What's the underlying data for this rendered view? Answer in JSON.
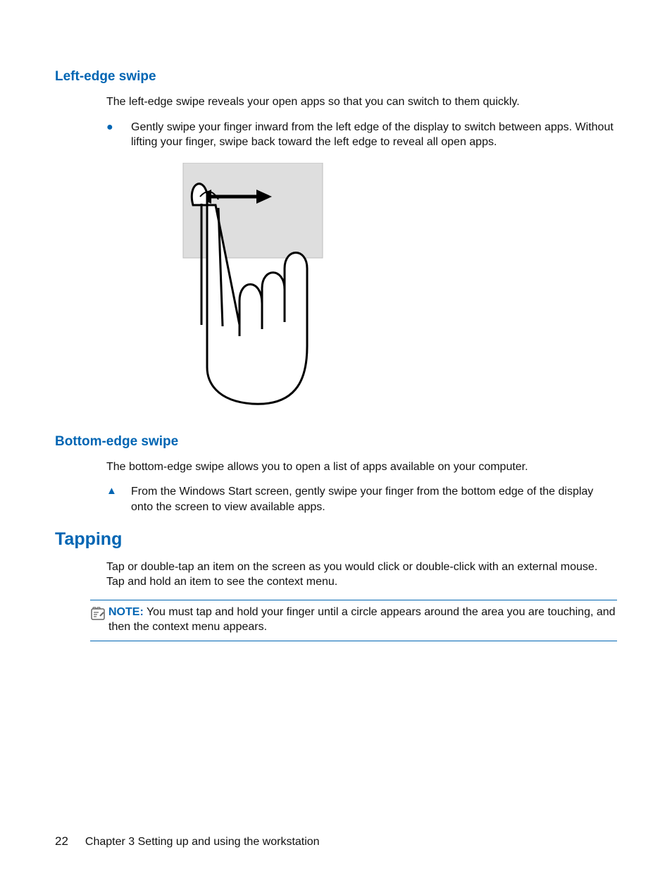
{
  "section1": {
    "heading": "Left-edge swipe",
    "intro": "The left-edge swipe reveals your open apps so that you can switch to them quickly.",
    "bullet": "Gently swipe your finger inward from the left edge of the display to switch between apps. Without lifting your finger, swipe back toward the left edge to reveal all open apps."
  },
  "section2": {
    "heading": "Bottom-edge swipe",
    "intro": "The bottom-edge swipe allows you to open a list of apps available on your computer.",
    "bullet": "From the Windows Start screen, gently swipe your finger from the bottom edge of the display onto the screen to view available apps."
  },
  "section3": {
    "heading": "Tapping",
    "intro": "Tap or double-tap an item on the screen as you would click or double-click with an external mouse. Tap and hold an item to see the context menu.",
    "note_label": "NOTE:",
    "note_text": "You must tap and hold your finger until a circle appears around the area you are touching, and then the context menu appears."
  },
  "footer": {
    "page": "22",
    "chapter": "Chapter 3   Setting up and using the workstation"
  }
}
